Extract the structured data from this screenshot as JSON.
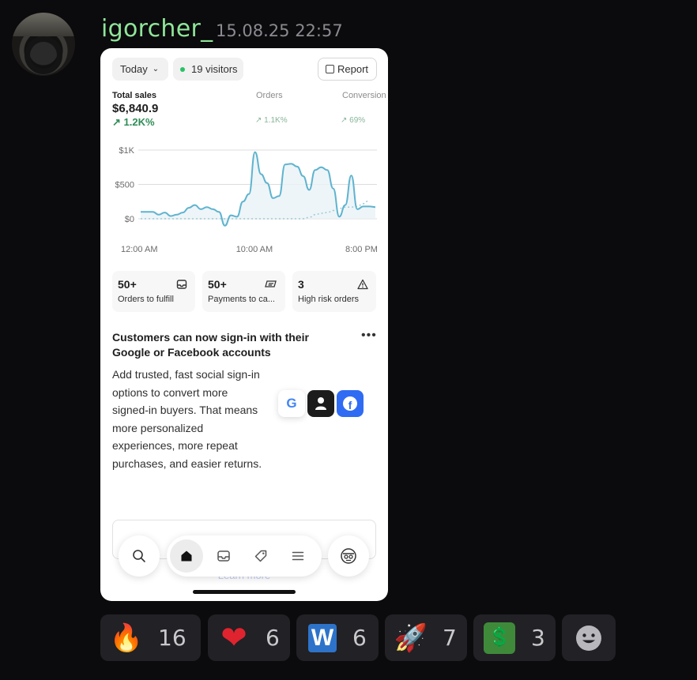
{
  "message": {
    "username": "igorcher_",
    "timestamp": "15.08.25 22:57"
  },
  "dashboard": {
    "date_filter": "Today",
    "visitors": "19 visitors",
    "report_button": "Report",
    "metrics": [
      {
        "title": "Total sales",
        "value": "$6,840.9",
        "delta": "↗ 1.2K%"
      },
      {
        "title": "Orders",
        "delta": "↗ 1.1K%"
      },
      {
        "title": "Conversion",
        "delta": "↗ 69%"
      }
    ],
    "cards": [
      {
        "value": "50+",
        "label": "Orders to fulfill",
        "icon": "inbox-icon"
      },
      {
        "value": "50+",
        "label": "Payments to ca...",
        "icon": "cash-icon"
      },
      {
        "value": "3",
        "label": "High risk orders",
        "icon": "warning-icon"
      }
    ],
    "promo": {
      "title": "Customers can now sign-in with their Google or Facebook accounts",
      "body": "Add trusted, fast social sign-in options to convert more signed-in buyers. That means more personalized experiences, more repeat purchases, and easier returns.",
      "learn_more": "Learn more",
      "google_letter": "G",
      "facebook_letter": "f"
    },
    "nav": [
      "search-icon",
      "home-icon",
      "inbox-icon",
      "tag-icon",
      "menu-icon",
      "profile-icon"
    ]
  },
  "chart_data": {
    "type": "line",
    "y_ticks": [
      "$1K",
      "$500",
      "$0"
    ],
    "x_ticks": [
      "12:00 AM",
      "10:00 AM",
      "8:00 PM"
    ],
    "ylim": [
      -150,
      1000
    ],
    "series": [
      {
        "values": [
          100,
          100,
          100,
          60,
          90,
          40,
          60,
          90,
          160,
          200,
          140,
          170,
          140,
          100,
          -100,
          50,
          30,
          250,
          360,
          970,
          650,
          520,
          300,
          330,
          790,
          800,
          760,
          620,
          420,
          710,
          750,
          710,
          440,
          30,
          200,
          630,
          140,
          180,
          180,
          170
        ]
      },
      {
        "dashed": true,
        "values": [
          0,
          0,
          0,
          0,
          0,
          0,
          0,
          0,
          0,
          0,
          0,
          0,
          0,
          0,
          0,
          0,
          0,
          0,
          0,
          0,
          0,
          0,
          0,
          0,
          0,
          0,
          0,
          0,
          20,
          60,
          80,
          90,
          120,
          150,
          170,
          170,
          180,
          220,
          270
        ]
      }
    ],
    "grid": true,
    "colors": {
      "line": "#5fb3cf",
      "area": "#e8f2f6",
      "dashed": "#9cc9d6",
      "grid": "#dcdcdc"
    }
  },
  "reactions": [
    {
      "emoji": "🔥",
      "count": "16",
      "name": "fire-emoji"
    },
    {
      "emoji": "❤",
      "count": "6",
      "name": "heart-emoji"
    },
    {
      "emoji": "W",
      "count": "6",
      "name": "w-emoji"
    },
    {
      "emoji": "🚀",
      "count": "7",
      "name": "rocket-emoji"
    },
    {
      "emoji": "💲",
      "count": "3",
      "name": "pepe-money-emoji"
    }
  ],
  "add_reaction_icon": "smiley-icon"
}
